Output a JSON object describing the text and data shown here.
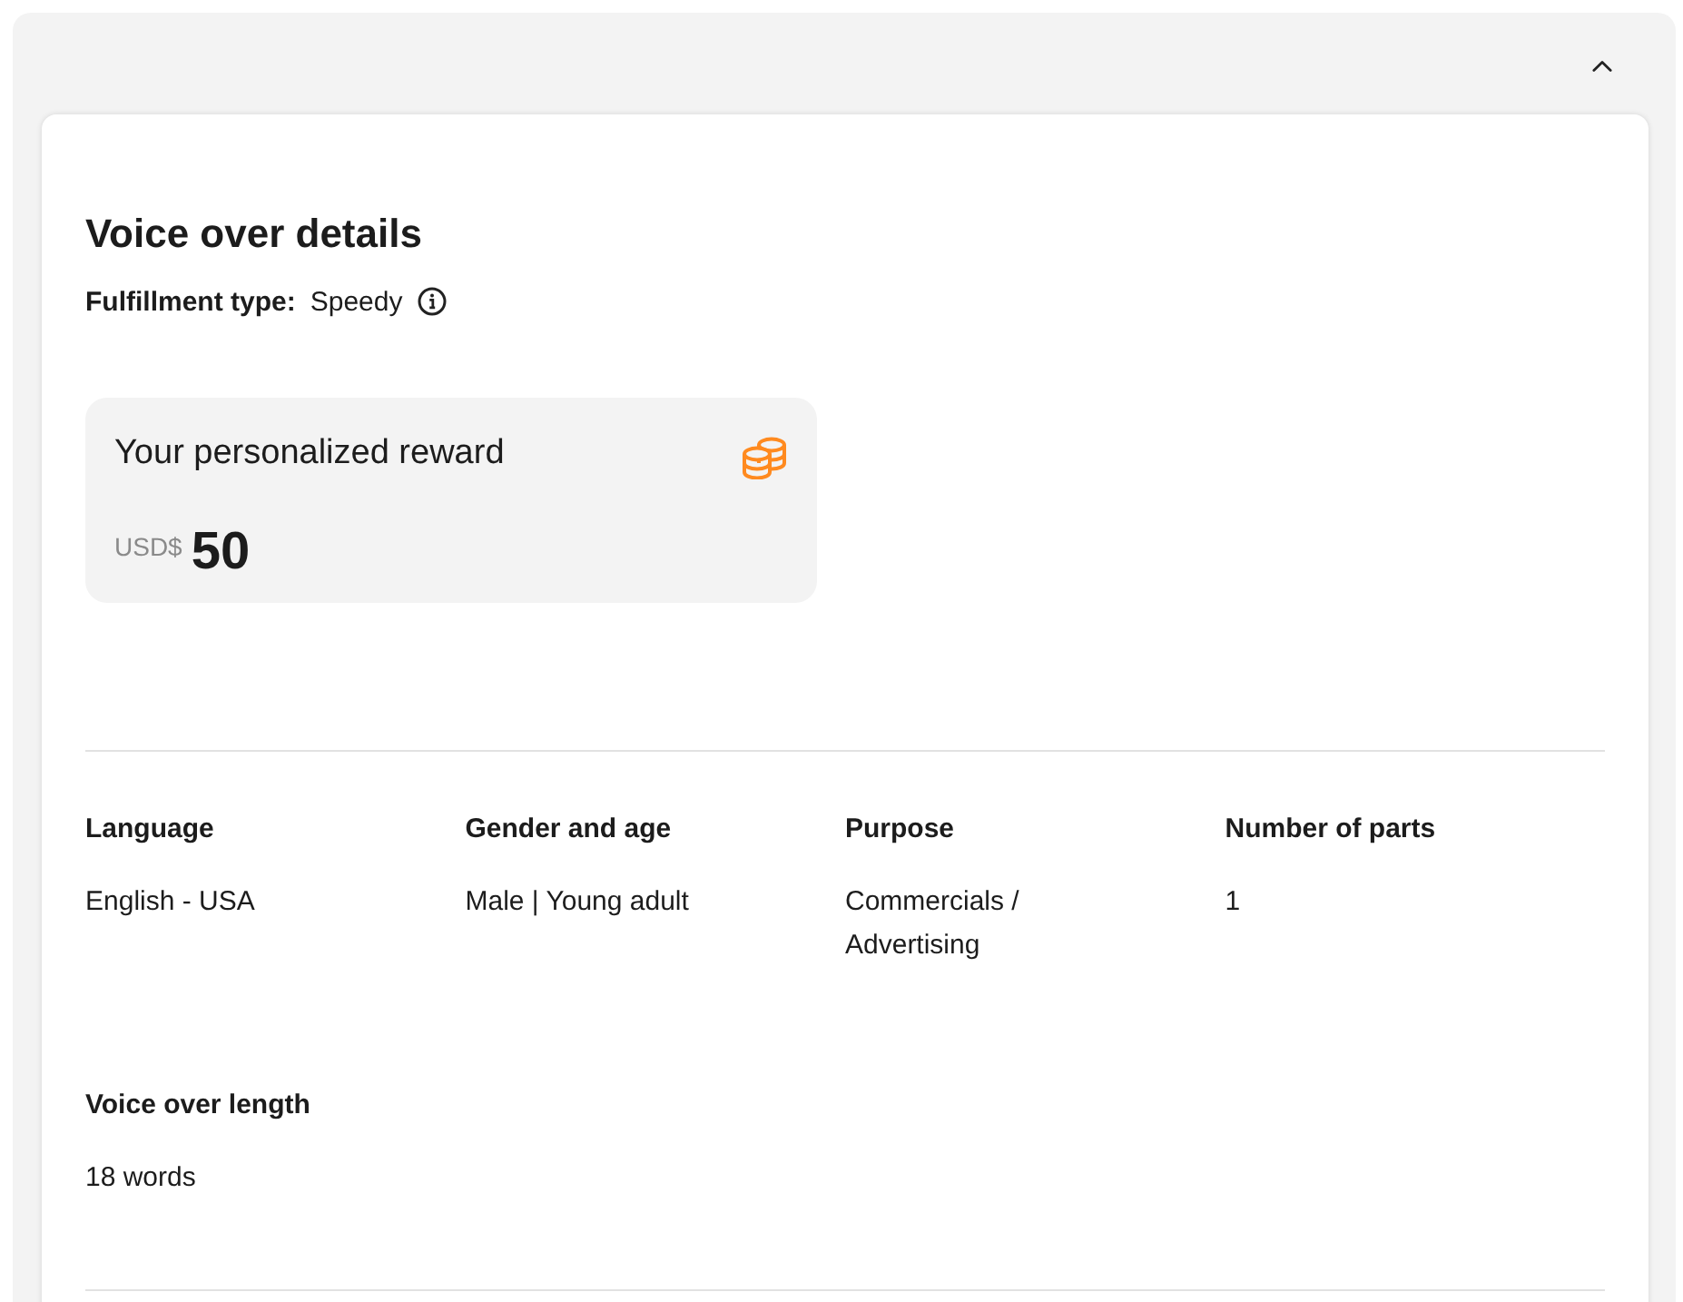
{
  "panel": {
    "expanded": true
  },
  "details": {
    "title": "Voice over details",
    "fulfillment": {
      "label": "Fulfillment type:",
      "value": "Speedy"
    }
  },
  "reward": {
    "title": "Your personalized reward",
    "currency": "USD$",
    "amount": "50"
  },
  "fields": [
    {
      "label": "Language",
      "value": "English - USA"
    },
    {
      "label": "Gender and age",
      "value": "Male | Young adult"
    },
    {
      "label": "Purpose",
      "value": "Commercials / Advertising"
    },
    {
      "label": "Number of parts",
      "value": "1"
    },
    {
      "label": "Voice over length",
      "value": "18 words"
    }
  ]
}
